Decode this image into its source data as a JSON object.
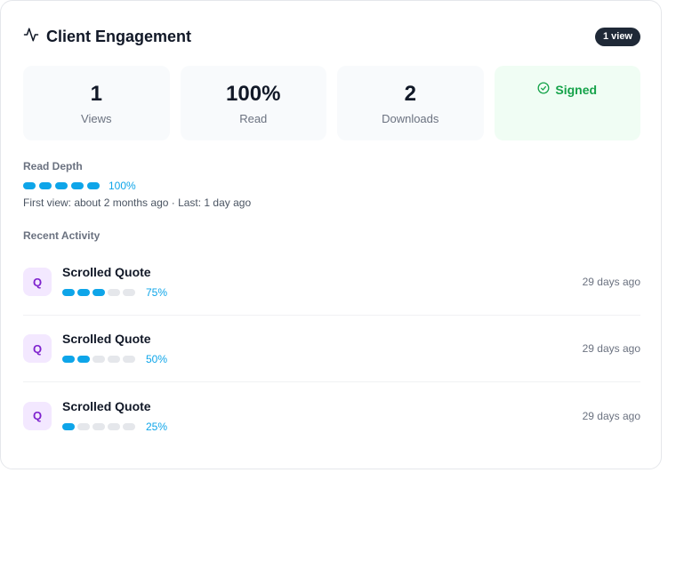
{
  "header": {
    "title": "Client Engagement",
    "icon": "activity-icon",
    "badge": "1 view"
  },
  "stats": [
    {
      "value": "1",
      "label": "Views"
    },
    {
      "value": "100%",
      "label": "Read"
    },
    {
      "value": "2",
      "label": "Downloads"
    }
  ],
  "signed": {
    "label": "Signed",
    "icon": "check-circle-icon",
    "color": "#16a34a"
  },
  "read_depth": {
    "label": "Read Depth",
    "segments_total": 5,
    "segments_filled": 5,
    "percent": "100%",
    "meta": "First view: about 2 months ago · Last: 1 day ago"
  },
  "recent": {
    "label": "Recent Activity",
    "items": [
      {
        "initial": "Q",
        "title": "Scrolled Quote",
        "filled": 3,
        "total": 5,
        "percent": "75%",
        "time": "29 days ago"
      },
      {
        "initial": "Q",
        "title": "Scrolled Quote",
        "filled": 2,
        "total": 5,
        "percent": "50%",
        "time": "29 days ago"
      },
      {
        "initial": "Q",
        "title": "Scrolled Quote",
        "filled": 1,
        "total": 5,
        "percent": "25%",
        "time": "29 days ago"
      }
    ]
  },
  "colors": {
    "accent": "#0ea5e9",
    "success": "#16a34a",
    "avatar_bg": "#f3e8ff",
    "avatar_fg": "#7e22ce"
  }
}
